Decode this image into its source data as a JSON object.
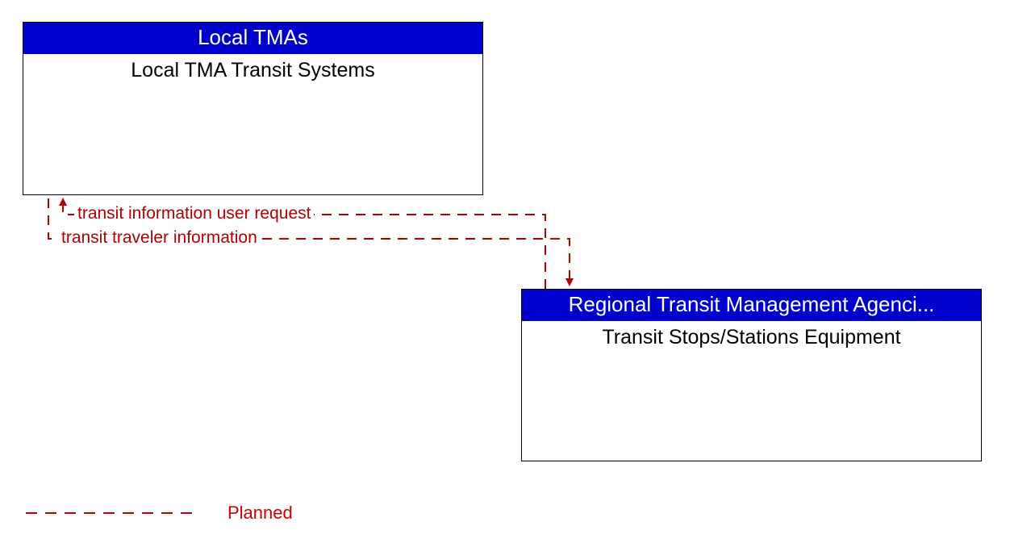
{
  "boxes": {
    "top": {
      "header": "Local TMAs",
      "body": "Local TMA Transit Systems"
    },
    "bottom": {
      "header": "Regional Transit Management Agenci...",
      "body": "Transit Stops/Stations Equipment"
    }
  },
  "flows": {
    "request": "transit information user request",
    "info": "transit traveler information"
  },
  "legend": {
    "planned": "Planned"
  },
  "colors": {
    "header_bg": "#0000cc",
    "planned_line": "#b00000"
  }
}
